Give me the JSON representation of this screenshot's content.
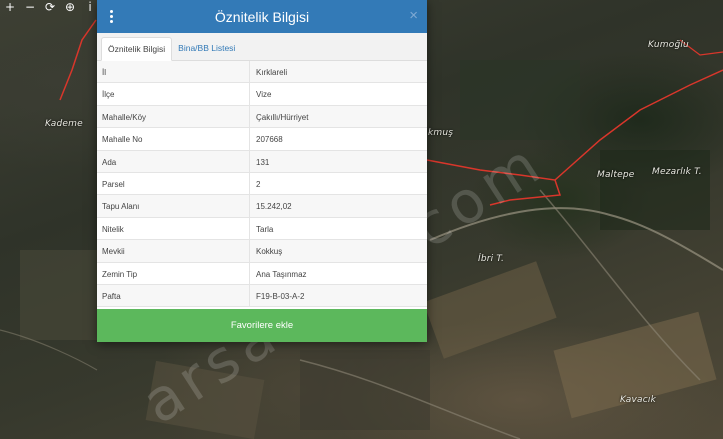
{
  "map": {
    "labels": [
      "Kademe",
      "Kumoğlu",
      "Maltepe",
      "Mezarlık T.",
      "Kavacık",
      "İbri T.",
      "kmuş"
    ],
    "watermark": "arsaofisi.com"
  },
  "toolbar": {
    "icons": [
      "plus-icon",
      "minus-icon",
      "refresh-icon",
      "locate-icon",
      "info-icon"
    ],
    "glyphs": [
      "+",
      "−",
      "⟳",
      "⊕",
      "i"
    ]
  },
  "dialog": {
    "title": "Öznitelik Bilgisi",
    "close_glyph": "×",
    "tabs": [
      {
        "label": "Öznitelik Bilgisi",
        "active": true
      },
      {
        "label": "Bina/BB Listesi",
        "active": false
      }
    ],
    "rows": [
      {
        "label": "İl",
        "value": "Kırklareli"
      },
      {
        "label": "İlçe",
        "value": "Vize"
      },
      {
        "label": "Mahalle/Köy",
        "value": "Çakıllı/Hürriyet"
      },
      {
        "label": "Mahalle No",
        "value": "207668"
      },
      {
        "label": "Ada",
        "value": "131"
      },
      {
        "label": "Parsel",
        "value": "2"
      },
      {
        "label": "Tapu Alanı",
        "value": "15.242,02"
      },
      {
        "label": "Nitelik",
        "value": "Tarla"
      },
      {
        "label": "Mevkii",
        "value": "Kokkuş"
      },
      {
        "label": "Zemin Tip",
        "value": "Ana Taşınmaz"
      },
      {
        "label": "Pafta",
        "value": "F19-B-03-A-2"
      }
    ],
    "favorite_button": "Favorilere ekle"
  },
  "colors": {
    "header": "#337ab7",
    "button": "#5cb85c",
    "parcel_border": "#d9362b"
  }
}
